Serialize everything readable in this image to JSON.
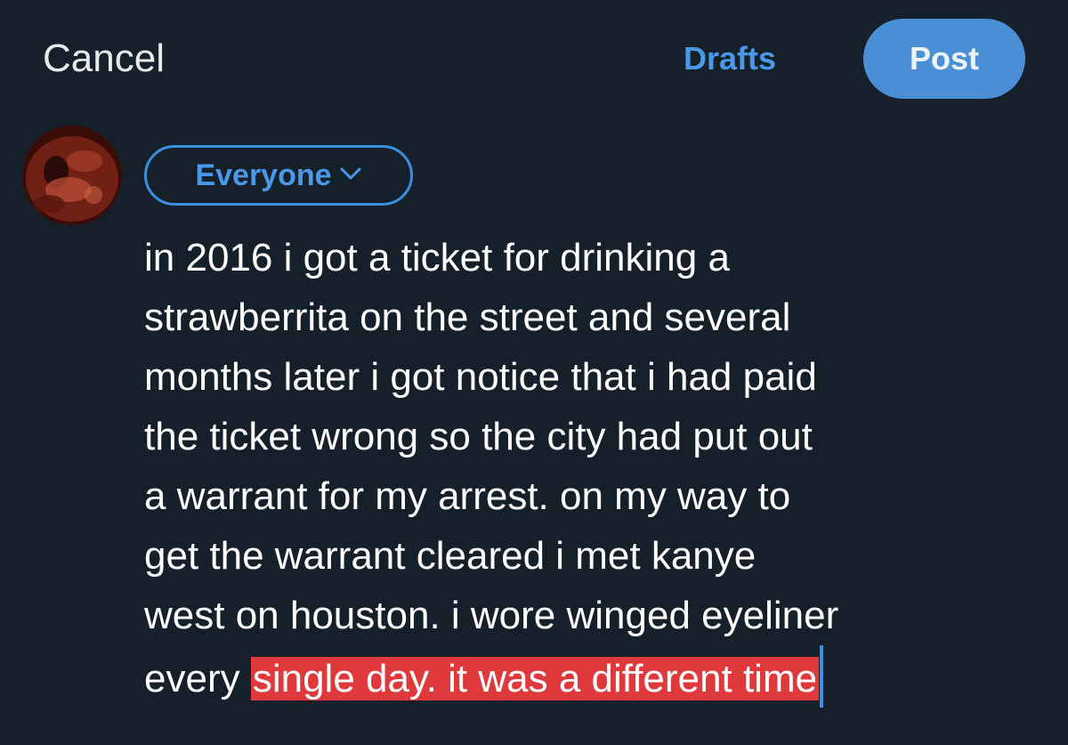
{
  "header": {
    "cancel_label": "Cancel",
    "drafts_label": "Drafts",
    "post_label": "Post"
  },
  "composer": {
    "audience_label": "Everyone",
    "text_lines": [
      "in 2016 i got a ticket for drinking a",
      "strawberrita on the street and several",
      "months later i got notice that i had paid",
      "the ticket wrong so the city had put out",
      "a warrant for my arrest. on my way to",
      "get the warrant cleared i met kanye",
      "west on houston. i wore winged eyeliner"
    ],
    "last_line_plain": "every ",
    "last_line_selected": "single day. it was a different time"
  },
  "colors": {
    "background": "#15202b",
    "accent": "#4a99e9",
    "post_button": "#4a8fd6",
    "selection": "#e0393b"
  },
  "icons": {
    "audience_dropdown": "chevron-down-icon",
    "avatar": "avatar"
  }
}
